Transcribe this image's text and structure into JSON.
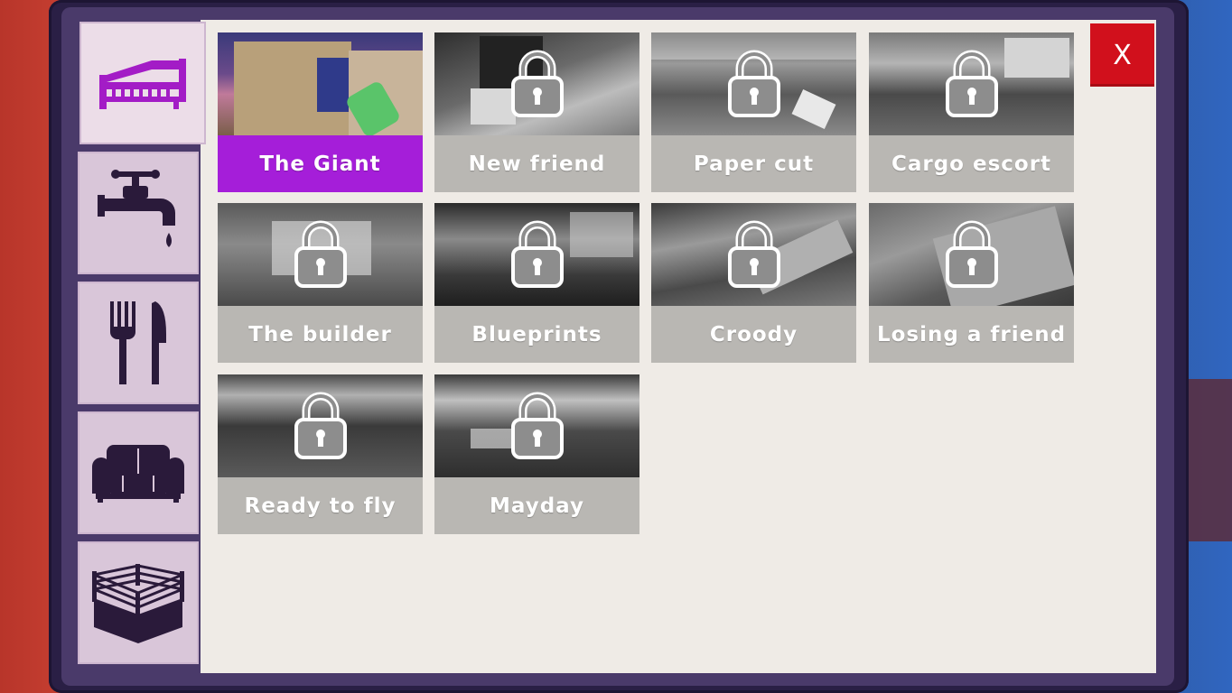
{
  "close_button": {
    "label": "X"
  },
  "categories": [
    {
      "icon": "bed-icon",
      "active": true
    },
    {
      "icon": "faucet-icon",
      "active": false
    },
    {
      "icon": "fork-knife-icon",
      "active": false
    },
    {
      "icon": "sofa-icon",
      "active": false
    },
    {
      "icon": "boxing-ring-icon",
      "active": false
    }
  ],
  "levels": [
    {
      "name": "The Giant",
      "locked": false,
      "selected": true
    },
    {
      "name": "New friend",
      "locked": true,
      "selected": false
    },
    {
      "name": "Paper cut",
      "locked": true,
      "selected": false
    },
    {
      "name": "Cargo escort",
      "locked": true,
      "selected": false
    },
    {
      "name": "The builder",
      "locked": true,
      "selected": false
    },
    {
      "name": "Blueprints",
      "locked": true,
      "selected": false
    },
    {
      "name": "Croody",
      "locked": true,
      "selected": false
    },
    {
      "name": "Losing a friend",
      "locked": true,
      "selected": false
    },
    {
      "name": "Ready to fly",
      "locked": true,
      "selected": false
    },
    {
      "name": "Mayday",
      "locked": true,
      "selected": false
    }
  ],
  "colors": {
    "accent": "#a51ed9",
    "close": "#d1101c",
    "locked_label_bg": "#b9b7b3",
    "panel": "#efebe6"
  }
}
